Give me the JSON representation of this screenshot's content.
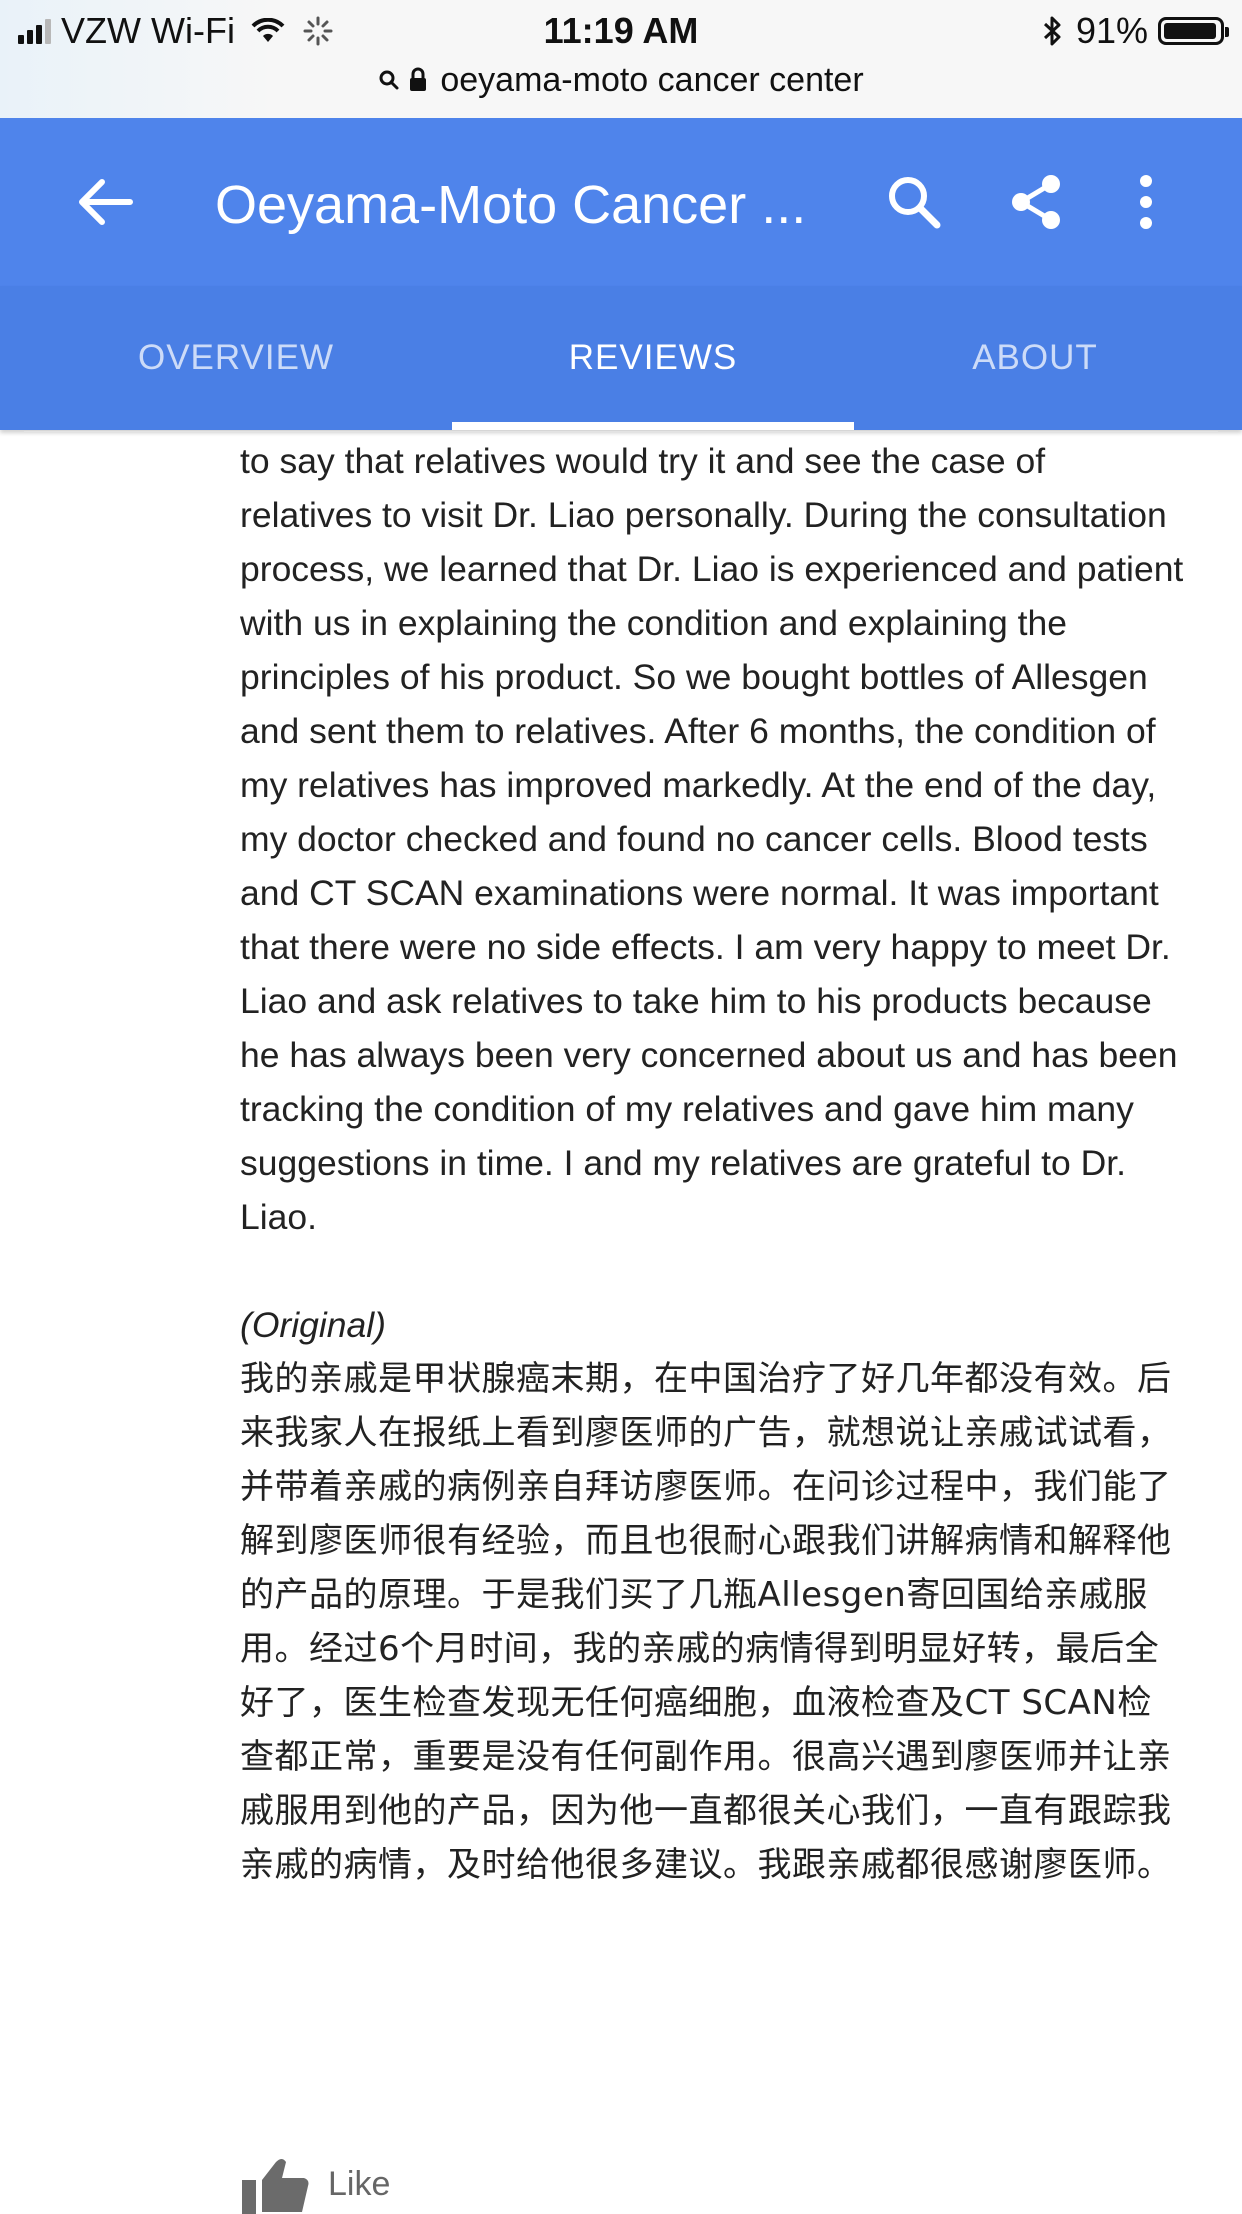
{
  "status_bar": {
    "carrier": "VZW Wi-Fi",
    "time": "11:19 AM",
    "battery": "91%",
    "signal_bars": 3,
    "icons": [
      "signal-icon",
      "wifi-icon",
      "loading-icon",
      "bluetooth-icon",
      "battery-icon"
    ]
  },
  "address_bar": {
    "url": "oeyama-moto cancer center",
    "icons": [
      "search-icon",
      "lock-icon"
    ]
  },
  "app_bar": {
    "title": "Oeyama-Moto Cancer ...",
    "icons": [
      "back-arrow-icon",
      "search-icon",
      "share-icon",
      "more-vert-icon"
    ]
  },
  "tabs": [
    {
      "label": "OVERVIEW",
      "active": false
    },
    {
      "label": "REVIEWS",
      "active": true
    },
    {
      "label": "ABOUT",
      "active": false
    }
  ],
  "review": {
    "translated_text": "to say that relatives would try it and see the case of relatives to visit Dr. Liao personally. During the consultation process, we learned that Dr. Liao is experienced and patient with us in explaining the condition and explaining the principles of his product. So we bought bottles of Allesgen and sent them to relatives. After 6 months, the condition of my relatives has improved markedly. At the end of the day, my doctor checked and found no cancer cells. Blood tests and CT SCAN examinations were normal. It was important that there were no side effects. I am very happy to meet Dr. Liao and ask relatives to take him to his products because he has always been very concerned about us and has been tracking the condition of my relatives and gave him many suggestions in time. I and my relatives are grateful to Dr. Liao.",
    "original_label": "(Original)",
    "original_text": "我的亲戚是甲状腺癌末期，在中国治疗了好几年都没有效。后来我家人在报纸上看到廖医师的广告，就想说让亲戚试试看，并带着亲戚的病例亲自拜访廖医师。在问诊过程中，我们能了解到廖医师很有经验，而且也很耐心跟我们讲解病情和解释他的产品的原理。于是我们买了几瓶Allesgen寄回国给亲戚服用。经过6个月时间，我的亲戚的病情得到明显好转，最后全好了，医生检查发现无任何癌细胞，血液检查及CT SCAN检查都正常，重要是没有任何副作用。很高兴遇到廖医师并让亲戚服用到他的产品，因为他一直都很关心我们，一直有跟踪我亲戚的病情，及时给他很多建议。我跟亲戚都很感谢廖医师。"
  },
  "like": {
    "label": "Like",
    "icon": "thumb-up-icon"
  },
  "colors": {
    "app_bar": "#4f84eb",
    "tab_bar": "#4a7fe5",
    "text": "#222222"
  }
}
